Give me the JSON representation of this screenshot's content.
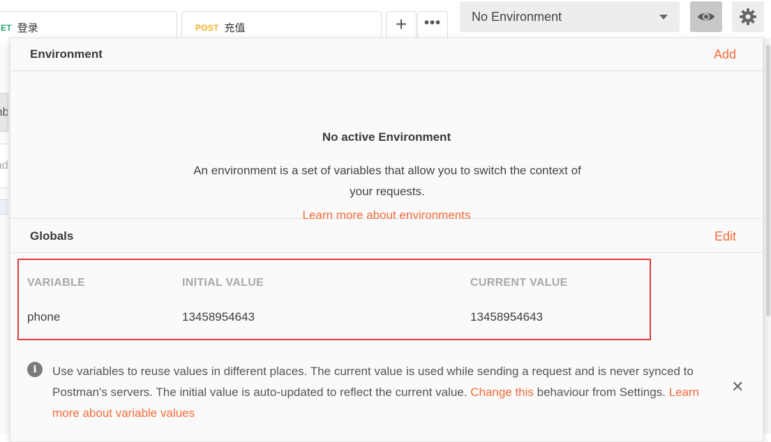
{
  "tabs": [
    {
      "method": "ET",
      "label": "登录",
      "method_color": "#1faa6f"
    },
    {
      "method": "POST",
      "label": "充值",
      "method_color": "#f2b01e"
    }
  ],
  "toolbar": {
    "add_tab_icon": "plus-icon",
    "more_icon": "ellipsis-icon",
    "environment_selected": "No Environment",
    "eye_icon": "eye-icon",
    "settings_icon": "gear-icon"
  },
  "background": {
    "fragment_1": "nb",
    "fragment_2": "ad"
  },
  "environment": {
    "title": "Environment",
    "action": "Add",
    "empty_title": "No active Environment",
    "empty_description": "An environment is a set of variables that allow you to switch the context of your requests.",
    "learn_link": "Learn more about environments"
  },
  "globals": {
    "title": "Globals",
    "action": "Edit",
    "columns": [
      "VARIABLE",
      "INITIAL VALUE",
      "CURRENT VALUE"
    ],
    "rows": [
      {
        "variable": "phone",
        "initial": "13458954643",
        "current": "13458954643"
      }
    ]
  },
  "info": {
    "icon": "info-icon",
    "text_1": "Use variables to reuse values in different places. The current value is used while sending a request and is never synced to Postman's servers. The initial value is auto-updated to reflect the current value. ",
    "link_1": "Change this",
    "text_2": " behaviour from Settings. ",
    "link_2": "Learn more about variable values",
    "close_icon": "close-icon"
  },
  "colors": {
    "accent": "#f26b3a",
    "highlight_box": "#e03a3a"
  }
}
